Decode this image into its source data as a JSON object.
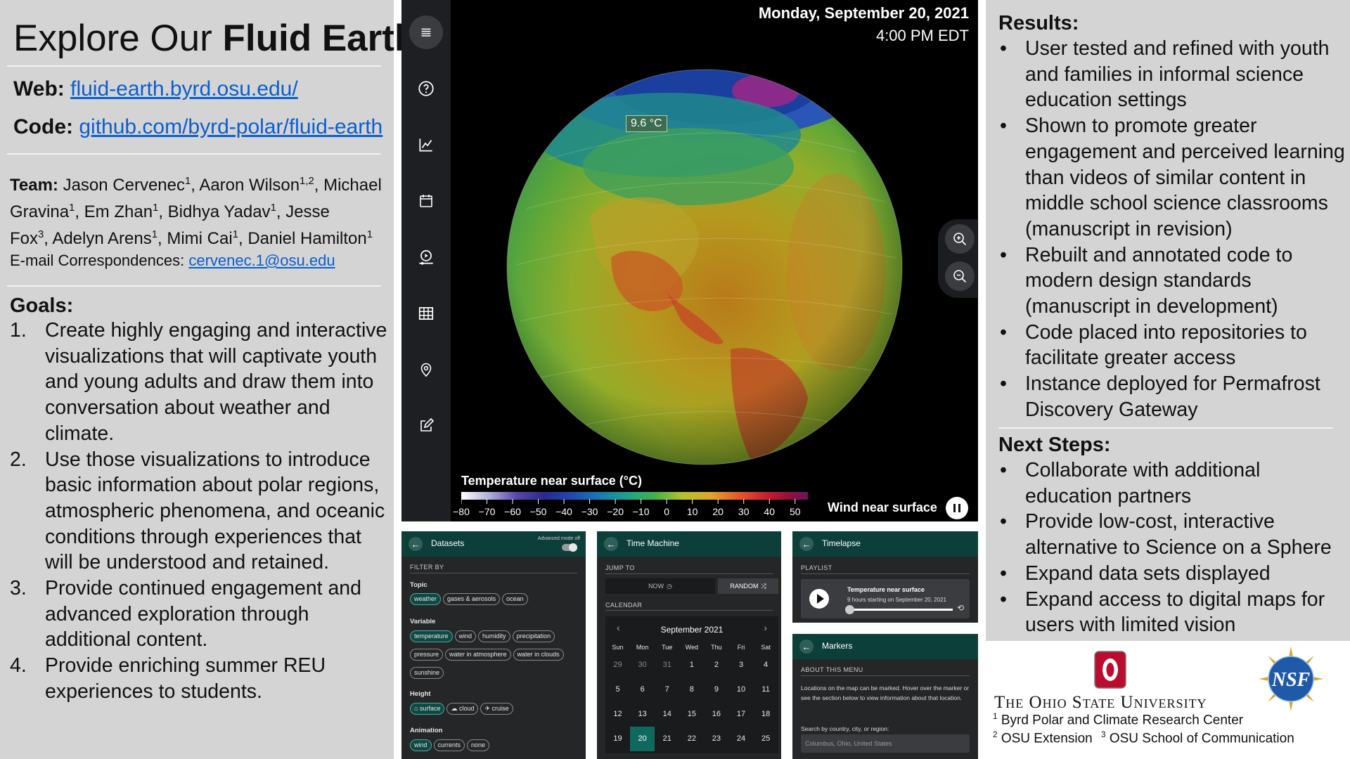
{
  "poster": {
    "title_regular": "Explore Our ",
    "title_bold": "Fluid Earth",
    "web_label": "Web:",
    "web_url": "fluid-earth.byrd.osu.edu/",
    "code_label": "Code:",
    "code_url": "github.com/byrd-polar/fluid-earth",
    "team_label": "Team:",
    "team": [
      {
        "name": "Jason Cervenec",
        "aff": "1",
        "sep": ", "
      },
      {
        "name": "Aaron Wilson",
        "aff": "1,2",
        "sep": ", "
      },
      {
        "name": "Michael Gravina",
        "aff": "1",
        "sep": ", "
      },
      {
        "name": "Em Zhan",
        "aff": "1",
        "sep": ", "
      },
      {
        "name": "Bidhya Yadav",
        "aff": "1",
        "sep": ", "
      },
      {
        "name": "Jesse Fox",
        "aff": "3",
        "sep": ", "
      },
      {
        "name": "Adelyn Arens",
        "aff": "1",
        "sep": ", "
      },
      {
        "name": "Mimi Cai",
        "aff": "1",
        "sep": ", "
      },
      {
        "name": "Daniel Hamilton",
        "aff": "1",
        "sep": ""
      }
    ],
    "email_label": "E-mail Correspondences: ",
    "email": "cervenec.1@osu.edu",
    "goals_heading": "Goals:",
    "goals": [
      "Create highly engaging and interactive visualizations that will captivate youth and young adults and draw them into conversation about weather and climate.",
      "Use those visualizations to introduce basic information about polar regions, atmospheric phenomena, and oceanic conditions through experiences that will be understood and retained.",
      "Provide continued engagement and advanced exploration through additional content.",
      "Provide enriching summer REU experiences to students."
    ],
    "results_heading": "Results:",
    "results": [
      "User tested and refined with youth and families in informal science education settings",
      "Shown to promote greater engagement and perceived learning than videos of similar content in middle school science classrooms (manuscript in revision)",
      "Rebuilt and annotated code to modern design standards (manuscript in development)",
      "Code placed into repositories to facilitate greater access",
      "Instance deployed for Permafrost Discovery Gateway"
    ],
    "next_heading": "Next Steps:",
    "next_steps": [
      "Collaborate with additional education partners",
      "Provide low-cost, interactive alternative to Science on a Sphere",
      "Expand data sets displayed",
      "Expand access to digital maps for users with limited vision"
    ],
    "university": "The Ohio State University",
    "affiliations": [
      {
        "num": "1",
        "text": "Byrd Polar and Climate Research Center"
      },
      {
        "num": "2",
        "text": "OSU Extension"
      },
      {
        "num": "3",
        "text": "OSU School of Communication"
      }
    ],
    "nsf_logo_text": "NSF"
  },
  "app": {
    "date": "Monday, September 20, 2021",
    "time": "4:00 PM EDT",
    "temp_readout": "9.6 °C",
    "legend_title": "Temperature near surface (°C)",
    "legend_ticks": [
      "−80",
      "−70",
      "−60",
      "−50",
      "−40",
      "−30",
      "−20",
      "−10",
      "0",
      "10",
      "20",
      "30",
      "40",
      "50"
    ],
    "legend_min": -80,
    "legend_max": 55,
    "wind_label": "Wind near surface",
    "sidebar_icons": [
      "menu-icon",
      "help-icon",
      "chart-icon",
      "calendar-icon",
      "timelapse-icon",
      "grid-icon",
      "location-pin-icon",
      "edit-icon"
    ],
    "colors": {
      "panel_bg": "#d4d4d4",
      "header_teal": "#0d3f3a",
      "selected_teal": "#0e6a60",
      "link_blue": "#0b5ecf"
    }
  },
  "datasets": {
    "title": "Datasets",
    "advanced_label": "Advanced mode off",
    "filter_by": "FILTER BY",
    "topic_label": "Topic",
    "topics": [
      "weather",
      "gases & aerosols",
      "ocean"
    ],
    "variable_label": "Variable",
    "variables_row1": [
      "temperature",
      "wind",
      "humidity",
      "precipitation"
    ],
    "variables_row2": [
      "pressure",
      "water in atmosphere",
      "water in clouds"
    ],
    "variables_row3": [
      "sunshine"
    ],
    "height_label": "Height",
    "heights": [
      "surface",
      "cloud",
      "cruise"
    ],
    "animation_label": "Animation",
    "animations": [
      "wind",
      "currents",
      "none"
    ]
  },
  "time_machine": {
    "title": "Time Machine",
    "jump_to": "JUMP TO",
    "now_label": "NOW",
    "random_label": "RANDOM",
    "calendar_label": "CALENDAR",
    "month": "September 2021",
    "days_of_week": [
      "Sun",
      "Mon",
      "Tue",
      "Wed",
      "Thu",
      "Fri",
      "Sat"
    ],
    "weeks": [
      [
        "29",
        "30",
        "31",
        "1",
        "2",
        "3",
        "4"
      ],
      [
        "5",
        "6",
        "7",
        "8",
        "9",
        "10",
        "11"
      ],
      [
        "12",
        "13",
        "14",
        "15",
        "16",
        "17",
        "18"
      ],
      [
        "19",
        "20",
        "21",
        "22",
        "23",
        "24",
        "25"
      ]
    ],
    "selected_day": "20"
  },
  "timelapse": {
    "title": "Timelapse",
    "playlist_label": "PLAYLIST",
    "item_title": "Temperature near surface",
    "item_subtitle": "9 hours starting on September 20, 2021"
  },
  "markers": {
    "title": "Markers",
    "about_label": "ABOUT THIS MENU",
    "about_text": "Locations on the map can be marked. Hover over the marker or see the section below to view information about that location.",
    "search_label": "Search by country, city, or region:",
    "search_placeholder": "Columbus, Ohio, United States"
  }
}
